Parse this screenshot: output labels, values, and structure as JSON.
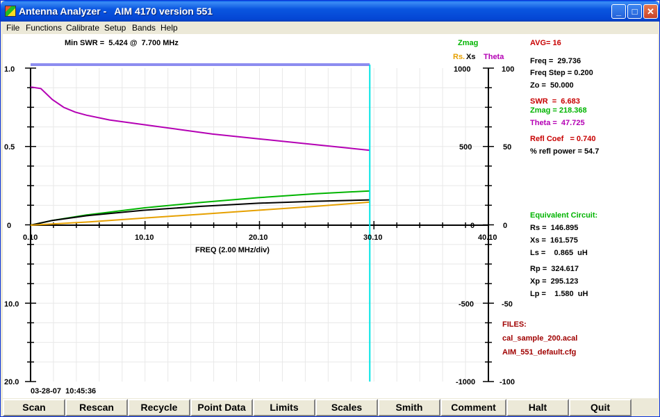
{
  "window": {
    "title": "Antenna Analyzer -   AIM 4170 version 551",
    "minimize": "_",
    "maximize": "□",
    "close": "✕"
  },
  "menu": [
    "File",
    "Functions",
    "Calibrate",
    "Setup",
    "Bands",
    "Help"
  ],
  "header": {
    "min_swr": "Min SWR =  5.424 @  7.700 MHz",
    "zmag_label": "Zmag",
    "rs_label": "Rs.",
    "xs_label": "Xs",
    "theta_label": "Theta"
  },
  "axes": {
    "left_top": [
      "1.0",
      "0.5",
      "0"
    ],
    "left_bottom": [
      "10.0",
      "20.0"
    ],
    "x_ticks": [
      "0.10",
      "10.10",
      "20.10",
      "30.10",
      "40.10"
    ],
    "xlabel": "FREQ (2.00 MHz/div)",
    "mid_ticks": [
      "1000",
      "500",
      "0",
      "-500",
      "-1000"
    ],
    "right_ticks": [
      "100",
      "50",
      "0",
      "-50",
      "-100"
    ],
    "timestamp": "03-28-07  10:45:36"
  },
  "readout": {
    "avg": "AVG= 16",
    "freq": "Freq =  29.736",
    "freq_step": "Freq Step = 0.200",
    "zo": "Zo =  50.000",
    "swr": "SWR  =  6.683",
    "zmag": "Zmag = 218.368",
    "theta": "Theta =  47.725",
    "refl_coef": "Refl Coef   = 0.740",
    "refl_power": "% refl power = 54.7",
    "eq_title": "Equivalent Circuit:",
    "rs": "Rs =  146.895",
    "xs": "Xs =  161.575",
    "ls": "Ls =    0.865  uH",
    "rp": "Rp =  324.617",
    "xp": "Xp =  295.123",
    "lp": "Lp =    1.580  uH",
    "files_title": "FILES:",
    "file1": "cal_sample_200.acal",
    "file2": "AIM_551_default.cfg"
  },
  "buttons": [
    "Scan",
    "Rescan",
    "Recycle",
    "Point Data",
    "Limits",
    "Scales",
    "Smith",
    "Comment",
    "Halt",
    "Quit"
  ],
  "colors": {
    "theta": "#b400b4",
    "zmag": "#00b400",
    "rs": "#e6a000",
    "xs": "#000000",
    "swr_label": "#c80000",
    "cursor": "#00e5e5",
    "scan_bar": "#8c8cf0"
  },
  "chart_data": {
    "type": "line",
    "xlabel": "FREQ (2.00 MHz/div)",
    "x_range": [
      0.1,
      40.1
    ],
    "cursor_x": 29.736,
    "scan_range": [
      0.1,
      29.736
    ],
    "series": [
      {
        "name": "Theta",
        "axis": "right_deg",
        "x": [
          0.1,
          1,
          2,
          3,
          4,
          5,
          7,
          10,
          13,
          16,
          20,
          24,
          28,
          29.736
        ],
        "y": [
          88,
          87,
          80,
          75,
          72,
          70,
          67,
          64,
          61,
          58,
          55,
          52,
          49,
          47.7
        ]
      },
      {
        "name": "Zmag",
        "axis": "ohms",
        "x": [
          0.1,
          2,
          5,
          10,
          15,
          20,
          25,
          29.736
        ],
        "y": [
          0,
          30,
          65,
          110,
          145,
          175,
          200,
          218
        ]
      },
      {
        "name": "Xs",
        "axis": "ohms",
        "x": [
          0.1,
          2,
          5,
          10,
          15,
          20,
          25,
          29.736
        ],
        "y": [
          0,
          30,
          60,
          95,
          120,
          140,
          152,
          161
        ]
      },
      {
        "name": "Rs",
        "axis": "ohms",
        "x": [
          0.1,
          5,
          10,
          15,
          20,
          25,
          29.736
        ],
        "y": [
          0,
          20,
          45,
          70,
          95,
          120,
          147
        ]
      }
    ]
  }
}
